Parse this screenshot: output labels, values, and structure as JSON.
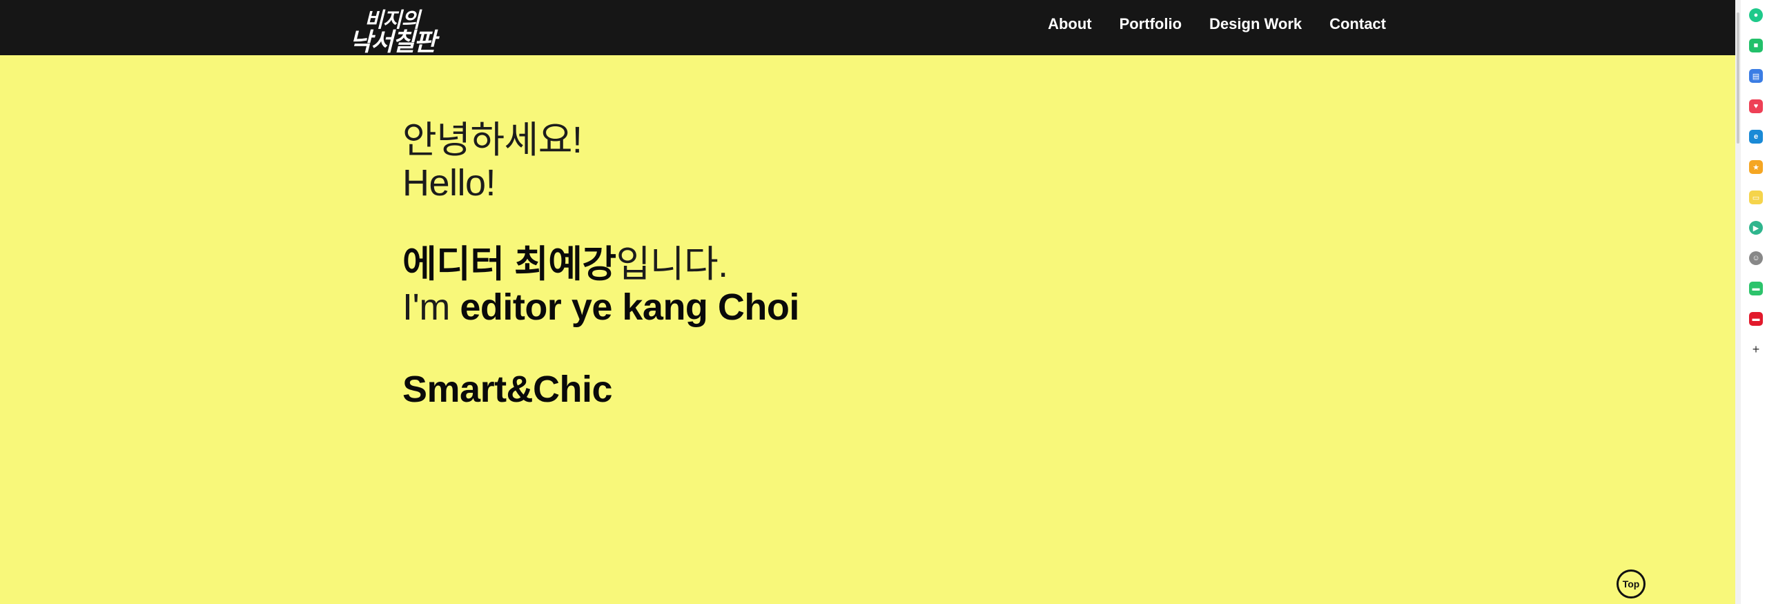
{
  "logo": {
    "line1": "비지의",
    "line2": "낙서칠판"
  },
  "nav": {
    "items": [
      {
        "label": "About"
      },
      {
        "label": "Portfolio"
      },
      {
        "label": "Design Work"
      },
      {
        "label": "Contact"
      }
    ]
  },
  "hero": {
    "greeting_ko": "안녕하세요!",
    "greeting_en": "Hello!",
    "intro_ko_bold": "에디터 최예강",
    "intro_ko_rest": "입니다.",
    "intro_en_prefix": "I'm ",
    "intro_en_bold": "editor ye kang Choi",
    "tagline": "Smart&Chic"
  },
  "top_button": {
    "label": "Top"
  },
  "sidebar": {
    "icons": [
      {
        "name": "green-circle-icon",
        "color": "#1ec98a",
        "glyph": "●"
      },
      {
        "name": "green-app-icon",
        "color": "#22c06a",
        "glyph": "■"
      },
      {
        "name": "blue-window-icon",
        "color": "#3b7de4",
        "glyph": "▤"
      },
      {
        "name": "red-pocket-icon",
        "color": "#ee4056",
        "glyph": "♥"
      },
      {
        "name": "edge-icon",
        "color": "#1a8ad6",
        "glyph": "e"
      },
      {
        "name": "orange-star-icon",
        "color": "#f5a623",
        "glyph": "★"
      },
      {
        "name": "yellow-note-icon",
        "color": "#f5d44b",
        "glyph": "▭"
      },
      {
        "name": "green-play-icon",
        "color": "#2fb58d",
        "glyph": "▶"
      },
      {
        "name": "avatar-icon",
        "color": "#888888",
        "glyph": "☺"
      },
      {
        "name": "green-webtoon-icon",
        "color": "#2cc36b",
        "glyph": "▬"
      },
      {
        "name": "red-app-icon",
        "color": "#e21a2c",
        "glyph": "▬"
      }
    ],
    "add_label": "+"
  },
  "colors": {
    "background": "#f8f87a",
    "navbar": "#161616",
    "text": "#111111"
  }
}
